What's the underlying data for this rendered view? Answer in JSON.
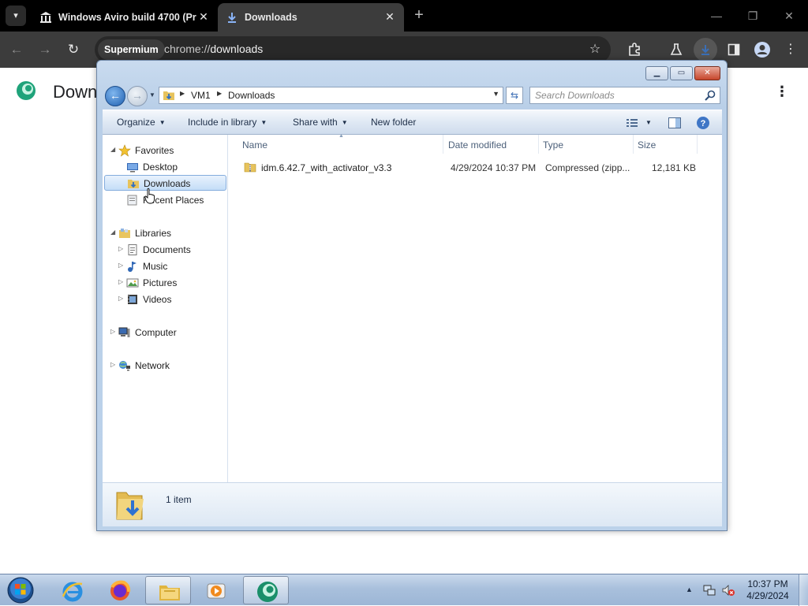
{
  "browser": {
    "tabs": [
      {
        "title": "Windows Aviro build 4700 (Pr",
        "active": false
      },
      {
        "title": "Downloads",
        "active": true
      }
    ],
    "new_tab_symbol": "+",
    "omnibox": {
      "chip_label": "Supermium",
      "url_prefix": "chrome://",
      "url_page": "downloads"
    },
    "page": {
      "title": "Downl"
    },
    "colors": {
      "tabstrip": "#000000",
      "toolbar": "#3c3c3c",
      "omnibox": "#282828"
    }
  },
  "explorer": {
    "caption_buttons": [
      "minimize",
      "maximize",
      "close"
    ],
    "address": {
      "crumbs": [
        "VM1",
        "Downloads"
      ]
    },
    "search": {
      "placeholder": "Search Downloads"
    },
    "commands": [
      {
        "label": "Organize",
        "has_menu": true
      },
      {
        "label": "Include in library",
        "has_menu": true
      },
      {
        "label": "Share with",
        "has_menu": true
      },
      {
        "label": "New folder",
        "has_menu": false
      }
    ],
    "nav": {
      "favorites_label": "Favorites",
      "favorites": [
        {
          "label": "Desktop",
          "icon": "desktop-icon"
        },
        {
          "label": "Downloads",
          "icon": "downloads-folder-icon",
          "selected": true
        },
        {
          "label": "Recent Places",
          "icon": "recent-places-icon"
        }
      ],
      "libraries_label": "Libraries",
      "libraries": [
        {
          "label": "Documents",
          "icon": "documents-icon"
        },
        {
          "label": "Music",
          "icon": "music-icon"
        },
        {
          "label": "Pictures",
          "icon": "pictures-icon"
        },
        {
          "label": "Videos",
          "icon": "videos-icon"
        }
      ],
      "computer_label": "Computer",
      "network_label": "Network"
    },
    "columns": [
      "Name",
      "Date modified",
      "Type",
      "Size"
    ],
    "files": [
      {
        "name": "idm.6.42.7_with_activator_v3.3",
        "date_modified": "4/29/2024 10:37 PM",
        "type": "Compressed (zipp...",
        "size": "12,181 KB",
        "icon": "zip-folder-icon"
      }
    ],
    "status": {
      "item_count": "1 item"
    }
  },
  "taskbar": {
    "pinned": [
      {
        "name": "internet-explorer",
        "active": false
      },
      {
        "name": "firefox",
        "active": false
      },
      {
        "name": "file-explorer",
        "active": true
      },
      {
        "name": "media-player",
        "active": false
      },
      {
        "name": "supermium-browser",
        "active": true
      }
    ],
    "clock": {
      "time": "10:37 PM",
      "date": "4/29/2024"
    }
  }
}
